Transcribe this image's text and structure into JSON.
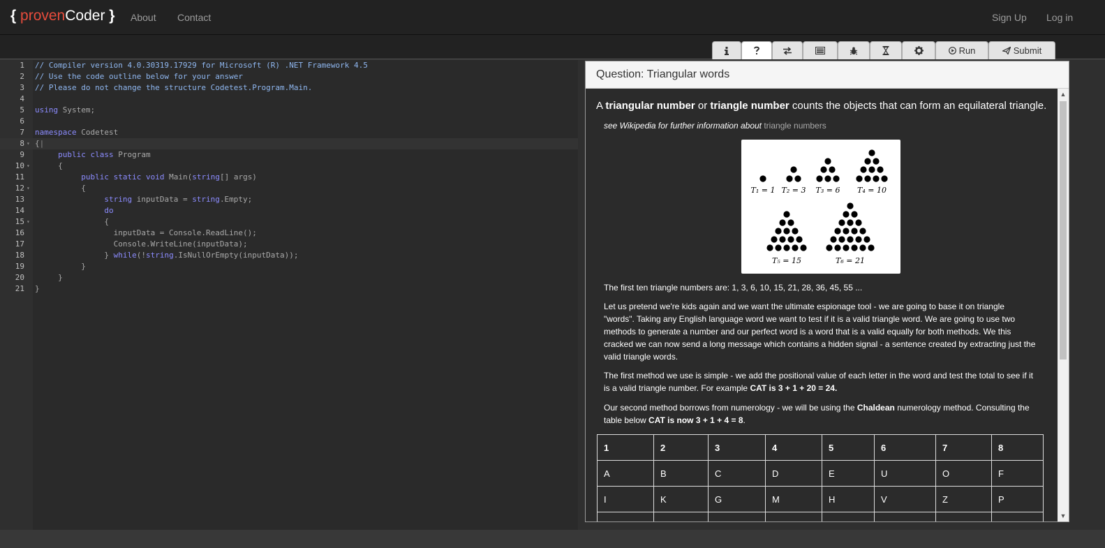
{
  "navbar": {
    "brand": {
      "open": "{ ",
      "proven": "proven",
      "coder": "Coder",
      "close": " }"
    },
    "links": [
      "About",
      "Contact"
    ],
    "right_links": [
      "Sign Up",
      "Log in"
    ]
  },
  "toolbar": {
    "tabs": [
      {
        "icon": "info-icon",
        "label": ""
      },
      {
        "icon": "question-icon",
        "label": ""
      },
      {
        "icon": "transfer-icon",
        "label": ""
      },
      {
        "icon": "list-icon",
        "label": ""
      },
      {
        "icon": "bug-icon",
        "label": ""
      },
      {
        "icon": "hourglass-icon",
        "label": ""
      },
      {
        "icon": "gear-icon",
        "label": ""
      },
      {
        "icon": "play-icon",
        "label": "Run"
      },
      {
        "icon": "send-icon",
        "label": "Submit"
      }
    ]
  },
  "editor": {
    "lines": [
      "// Compiler version 4.0.30319.17929 for Microsoft (R) .NET Framework 4.5",
      "// Use the code outline below for your answer",
      "// Please do not change the structure Codetest.Program.Main.",
      "",
      "using System;",
      "",
      "namespace Codetest",
      "{",
      "     public class Program",
      "     {",
      "          public static void Main(string[] args)",
      "          {",
      "               string inputData = string.Empty;",
      "               do",
      "               {",
      "                 inputData = Console.ReadLine();",
      "                 Console.WriteLine(inputData);",
      "               } while(!string.IsNullOrEmpty(inputData));",
      "          }",
      "     }",
      "}"
    ]
  },
  "question": {
    "title": "Question: Triangular words",
    "intro": {
      "p1": "A ",
      "b1": "triangular number",
      "p2": " or ",
      "b2": "triangle number",
      "p3": " counts the objects that can form an equilateral triangle."
    },
    "wiki": {
      "text": "see Wikipedia for further information about ",
      "link": "triangle numbers"
    },
    "figure_labels": [
      "T₁ = 1",
      "T₂ = 3",
      "T₃ = 6",
      "T₄ = 10",
      "T₅ = 15",
      "T₆ = 21"
    ],
    "first_ten": "The first ten triangle numbers are: 1, 3, 6, 10, 15, 21, 28, 36, 45, 55 ...",
    "para1": "Let us pretend we're kids again and we want the ultimate espionage tool - we are going to base it on triangle \"words\". Taking any English language word we want to test if it is a valid triangle word. We are going to use two methods to generate a number and our perfect word is a word that is a valid equally for both methods. We this cracked we can now send a long message which contains a hidden signal - a sentence created by extracting just the valid triangle words.",
    "para2": {
      "text": "The first method we use is simple - we add the positional value of each letter in the word and test the total to see if it is a valid triangle number. For example ",
      "bold": "CAT is 3 + 1 + 20 = 24."
    },
    "para3": {
      "p1": "Our second method borrows from numerology - we will be using the ",
      "b1": "Chaldean",
      "p2": " numerology method. Consulting the table below ",
      "b2": "CAT is now 3 + 1 + 4 = 8",
      "p3": "."
    },
    "table": {
      "header": [
        "1",
        "2",
        "3",
        "4",
        "5",
        "6",
        "7",
        "8"
      ],
      "rows": [
        [
          "A",
          "B",
          "C",
          "D",
          "E",
          "U",
          "O",
          "F"
        ],
        [
          "I",
          "K",
          "G",
          "M",
          "H",
          "V",
          "Z",
          "P"
        ],
        [
          "",
          "",
          "",
          "",
          "",
          "",
          "",
          ""
        ]
      ]
    }
  }
}
